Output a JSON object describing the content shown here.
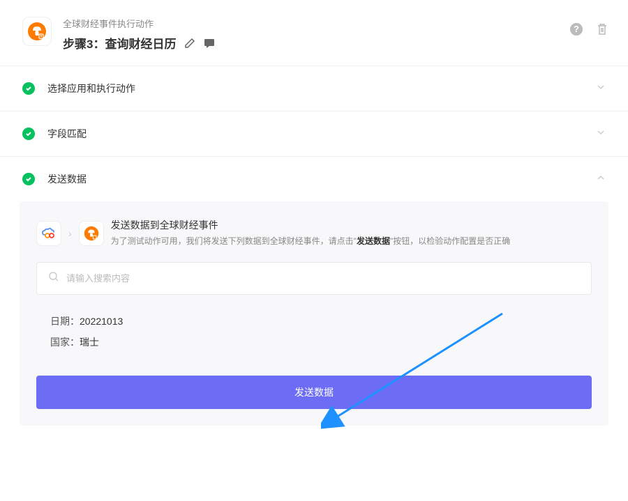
{
  "header": {
    "subtitle": "全球财经事件执行动作",
    "title": "步骤3：查询财经日历"
  },
  "sections": [
    {
      "title": "选择应用和执行动作",
      "expanded": false
    },
    {
      "title": "字段匹配",
      "expanded": false
    },
    {
      "title": "发送数据",
      "expanded": true
    }
  ],
  "panel": {
    "title": "发送数据到全球财经事件",
    "desc_prefix": "为了测试动作可用，我们将发送下列数据到全球财经事件，请点击\"",
    "desc_bold": "发送数据",
    "desc_suffix": "\"按钮，以检验动作配置是否正确"
  },
  "search": {
    "placeholder": "请输入搜索内容"
  },
  "data": {
    "date_label": "日期：",
    "date_value": "20221013",
    "country_label": "国家：",
    "country_value": "瑞士"
  },
  "button": {
    "send": "发送数据"
  }
}
